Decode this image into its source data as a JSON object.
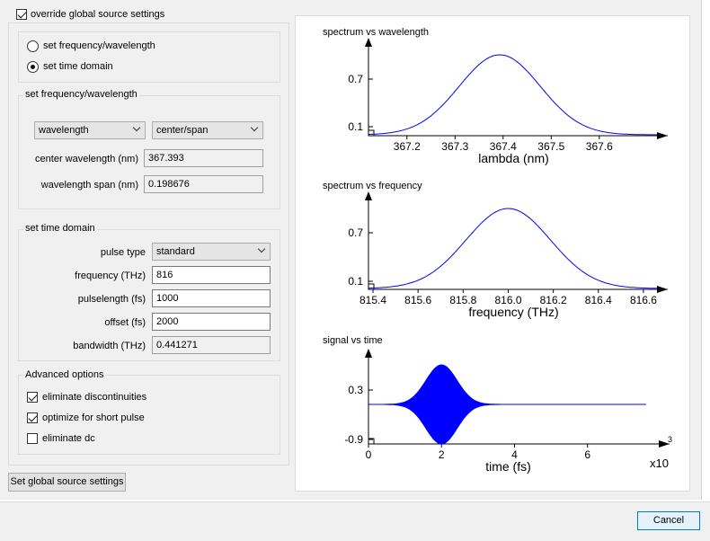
{
  "override": {
    "label": "override global source settings",
    "checked": true
  },
  "mode": {
    "freq_label": "set frequency/wavelength",
    "time_label": "set time domain",
    "selected": "time"
  },
  "freq_group": {
    "title": "set frequency/wavelength",
    "select1": "wavelength",
    "select2": "center/span",
    "center_label": "center wavelength (nm)",
    "center_value": "367.393",
    "span_label": "wavelength span (nm)",
    "span_value": "0.198676"
  },
  "time_group": {
    "title": "set time domain",
    "pulse_type_label": "pulse type",
    "pulse_type_value": "standard",
    "frequency_label": "frequency (THz)",
    "frequency_value": "816",
    "pulselength_label": "pulselength (fs)",
    "pulselength_value": "1000",
    "offset_label": "offset (fs)",
    "offset_value": "2000",
    "bandwidth_label": "bandwidth (THz)",
    "bandwidth_value": "0.441271"
  },
  "advanced": {
    "title": "Advanced options",
    "items": [
      {
        "label": "eliminate discontinuities",
        "checked": true
      },
      {
        "label": "optimize for short pulse",
        "checked": true
      },
      {
        "label": "eliminate dc",
        "checked": false
      }
    ]
  },
  "buttons": {
    "set_global": "Set global source settings",
    "cancel": "Cancel"
  },
  "colors": {
    "accent": "#0078d7",
    "curve": "#0000ff"
  },
  "chart_data": [
    {
      "type": "line",
      "title": "spectrum vs wavelength",
      "xlabel": "lambda (nm)",
      "ylabel": "",
      "xlim": [
        367.12,
        367.72
      ],
      "ylim": [
        0,
        1
      ],
      "xticks": [
        "367.2",
        "367.3",
        "367.4",
        "367.5",
        "367.6"
      ],
      "yticks": [
        "0.1",
        "0.7"
      ],
      "series": [
        {
          "shape": "gaussian",
          "center": 367.393,
          "fwhm": 0.1987,
          "peak": 0.93
        }
      ]
    },
    {
      "type": "line",
      "title": "spectrum vs frequency",
      "xlabel": "frequency (THz)",
      "ylabel": "",
      "xlim": [
        815.38,
        816.66
      ],
      "ylim": [
        0,
        1
      ],
      "xticks": [
        "815.4",
        "815.6",
        "815.8",
        "816.0",
        "816.2",
        "816.4",
        "816.6"
      ],
      "yticks": [
        "0.1",
        "0.7"
      ],
      "series": [
        {
          "shape": "gaussian",
          "center": 816.0,
          "fwhm": 0.4413,
          "peak": 0.93
        }
      ]
    },
    {
      "type": "area",
      "title": "signal vs time",
      "xlabel": "time (fs)",
      "ylabel": "",
      "xscale_label": "x10",
      "xscale_exponent": "3",
      "xlim": [
        0,
        7.8
      ],
      "ylim": [
        -1,
        1
      ],
      "xticks": [
        "0",
        "2",
        "4",
        "6"
      ],
      "yticks": [
        "0.3",
        "-0.9"
      ],
      "series": [
        {
          "shape": "gaussian-envelope",
          "center": 2.0,
          "fwhm": 1.0,
          "amplitude": 1.0
        }
      ]
    }
  ]
}
